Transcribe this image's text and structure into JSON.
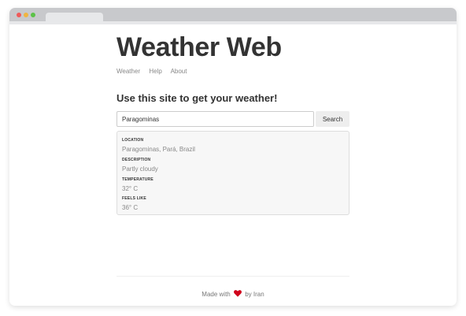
{
  "app": {
    "title": "Weather Web"
  },
  "nav": {
    "items": [
      {
        "label": "Weather"
      },
      {
        "label": "Help"
      },
      {
        "label": "About"
      }
    ]
  },
  "main": {
    "heading": "Use this site to get your weather!",
    "search": {
      "value": "Paragominas",
      "button_label": "Search"
    },
    "results": {
      "location": {
        "label": "LOCATION",
        "value": "Paragominas, Pará, Brazil"
      },
      "description": {
        "label": "DESCRIPTION",
        "value": "Partly cloudy"
      },
      "temperature": {
        "label": "TEMPERATURE",
        "value": "32° C"
      },
      "feels_like": {
        "label": "FEELS LIKE",
        "value": "36° C"
      }
    }
  },
  "footer": {
    "prefix": "Made with",
    "suffix": "by Iran",
    "heart_icon": "heart-icon"
  },
  "colors": {
    "heart": "#d0021b",
    "title_text": "#333333",
    "muted_text": "#888888",
    "button_bg": "#eeeeee"
  }
}
